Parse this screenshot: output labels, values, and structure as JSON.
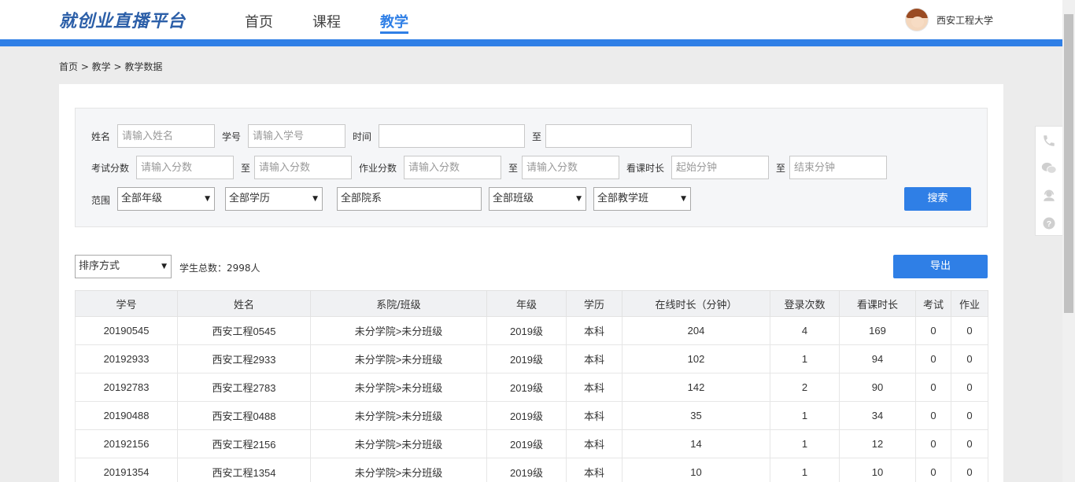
{
  "header": {
    "logo": "就创业直播平台",
    "nav": [
      "首页",
      "课程",
      "教学"
    ],
    "active_nav": "教学",
    "user_name": "西安工程大学"
  },
  "breadcrumb": "首页 > 教学 > 教学数据",
  "filters": {
    "name_label": "姓名",
    "name_placeholder": "请输入姓名",
    "id_label": "学号",
    "id_placeholder": "请输入学号",
    "time_label": "时间",
    "to_label": "至",
    "exam_label": "考试分数",
    "score_placeholder": "请输入分数",
    "homework_label": "作业分数",
    "watch_label": "看课时长",
    "start_min_placeholder": "起始分钟",
    "end_min_placeholder": "结束分钟",
    "scope_label": "范围",
    "grade_select": "全部年级",
    "education_select": "全部学历",
    "department_value": "全部院系",
    "class_select": "全部班级",
    "teaching_class_select": "全部教学班",
    "search_button": "搜索"
  },
  "toolbar": {
    "sort_select": "排序方式",
    "total_text": "学生总数：2998人",
    "export_button": "导出"
  },
  "table": {
    "columns": [
      "学号",
      "姓名",
      "系院/班级",
      "年级",
      "学历",
      "在线时长（分钟）",
      "登录次数",
      "看课时长",
      "考试",
      "作业"
    ],
    "rows": [
      [
        "20190545",
        "西安工程0545",
        "未分学院>未分班级",
        "2019级",
        "本科",
        "204",
        "4",
        "169",
        "0",
        "0"
      ],
      [
        "20192933",
        "西安工程2933",
        "未分学院>未分班级",
        "2019级",
        "本科",
        "102",
        "1",
        "94",
        "0",
        "0"
      ],
      [
        "20192783",
        "西安工程2783",
        "未分学院>未分班级",
        "2019级",
        "本科",
        "142",
        "2",
        "90",
        "0",
        "0"
      ],
      [
        "20190488",
        "西安工程0488",
        "未分学院>未分班级",
        "2019级",
        "本科",
        "35",
        "1",
        "34",
        "0",
        "0"
      ],
      [
        "20192156",
        "西安工程2156",
        "未分学院>未分班级",
        "2019级",
        "本科",
        "14",
        "1",
        "12",
        "0",
        "0"
      ],
      [
        "20191354",
        "西安工程1354",
        "未分学院>未分班级",
        "2019级",
        "本科",
        "10",
        "1",
        "10",
        "0",
        "0"
      ]
    ]
  },
  "side_tools": [
    "phone-icon",
    "wechat-icon",
    "customer-service-icon",
    "help-icon"
  ],
  "colors": {
    "accent": "#2f7fe6",
    "background": "#ececec"
  }
}
